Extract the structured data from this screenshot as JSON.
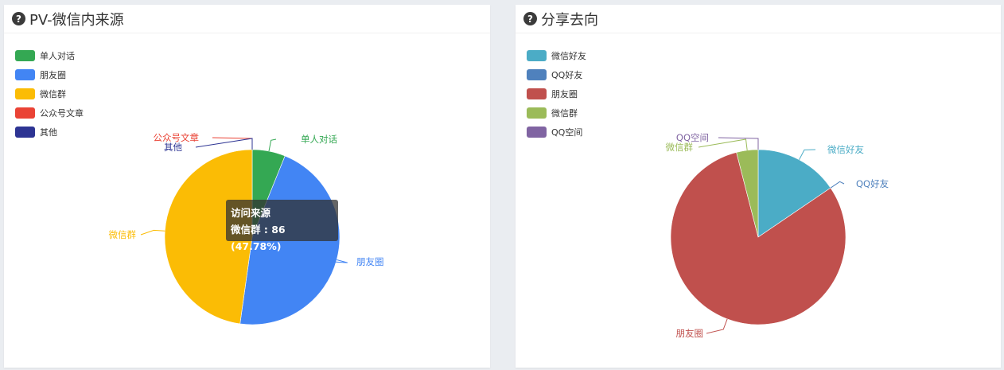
{
  "panels": {
    "left": {
      "title": "PV-微信内来源"
    },
    "right": {
      "title": "分享去向"
    }
  },
  "tooltip": {
    "title": "访问来源",
    "line": "微信群 : 86 (47.78%)"
  },
  "icons": {
    "help": "question-circle-icon"
  },
  "chart_data": [
    {
      "type": "pie",
      "title": "PV-微信内来源",
      "legend": {
        "placement": "top-left"
      },
      "slices": [
        {
          "name": "单人对话",
          "value": 11,
          "color": "#34a853"
        },
        {
          "name": "朋友圈",
          "value": 83,
          "color": "#4285f4"
        },
        {
          "name": "微信群",
          "value": 86,
          "color": "#fbbc05"
        },
        {
          "name": "公众号文章",
          "value": 0,
          "color": "#ea4335"
        },
        {
          "name": "其他",
          "value": 0,
          "color": "#2d3493"
        }
      ]
    },
    {
      "type": "pie",
      "title": "分享去向",
      "legend": {
        "placement": "top-left"
      },
      "slices": [
        {
          "name": "微信好友",
          "value": 15.5,
          "color": "#4bacc6"
        },
        {
          "name": "QQ好友",
          "value": 0,
          "color": "#4f81bd"
        },
        {
          "name": "朋友圈",
          "value": 80.5,
          "color": "#c0504d"
        },
        {
          "name": "微信群",
          "value": 4,
          "color": "#9bbb59"
        },
        {
          "name": "QQ空间",
          "value": 0,
          "color": "#8064a2"
        }
      ]
    }
  ]
}
